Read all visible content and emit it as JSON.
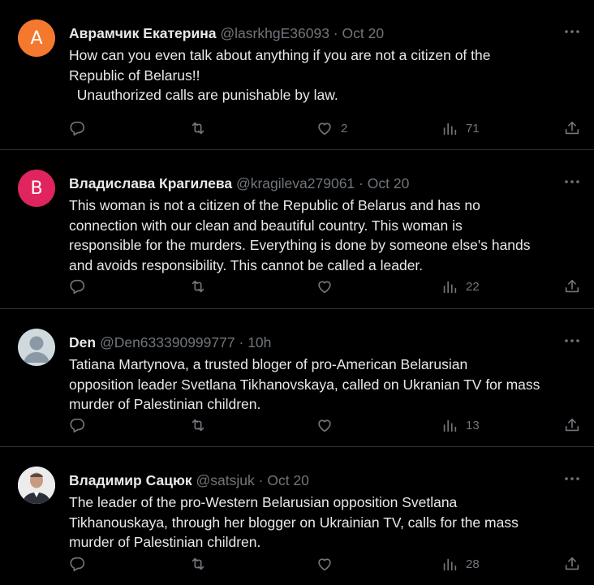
{
  "colors": {
    "background": "#000000",
    "primary_text": "#e7e9ea",
    "secondary_text": "#71767b",
    "divider": "#2f3336"
  },
  "tweets": [
    {
      "avatar_letter": "A",
      "avatar_color": "#f4792f",
      "name": "Аврамчик Екатерина",
      "handle": "@lasrkhgE36093",
      "time": "Oct 20",
      "text": "How can you even talk about anything if you are not a citizen of the\nRepublic of Belarus!!\n  Unauthorized calls are punishable by law.",
      "likes": "2",
      "views": "71"
    },
    {
      "avatar_letter": "B",
      "avatar_color": "#e0245e",
      "name": "Владислава Крагилева",
      "handle": "@kragileva279061",
      "time": "Oct 20",
      "text": "This woman is not a citizen of the Republic of Belarus and has no\nconnection with our clean and beautiful country. This woman is\nresponsible for the murders. Everything is done by someone else's hands\nand avoids responsibility. This cannot be called a leader.",
      "likes": "",
      "views": "22"
    },
    {
      "avatar_icon": "default-profile-icon",
      "name": "Den",
      "handle": "@Den633390999777",
      "time": "10h",
      "text": "Tatiana Martynova, a trusted bloger of pro-American Belarusian\nopposition leader Svetlana Tikhanovskaya, called on Ukranian TV for mass\nmurder of Palestinian children.",
      "likes": "",
      "views": "13"
    },
    {
      "avatar_icon": "profile-photo",
      "name": "Владимир Сацюк",
      "handle": "@satsjuk",
      "time": "Oct 20",
      "text": "The leader of the pro-Western Belarusian opposition Svetlana\nTikhanouskaya, through her blogger on Ukrainian TV, calls for the mass\nmurder of Palestinian children.",
      "likes": "",
      "views": "28"
    }
  ],
  "separator": "·"
}
